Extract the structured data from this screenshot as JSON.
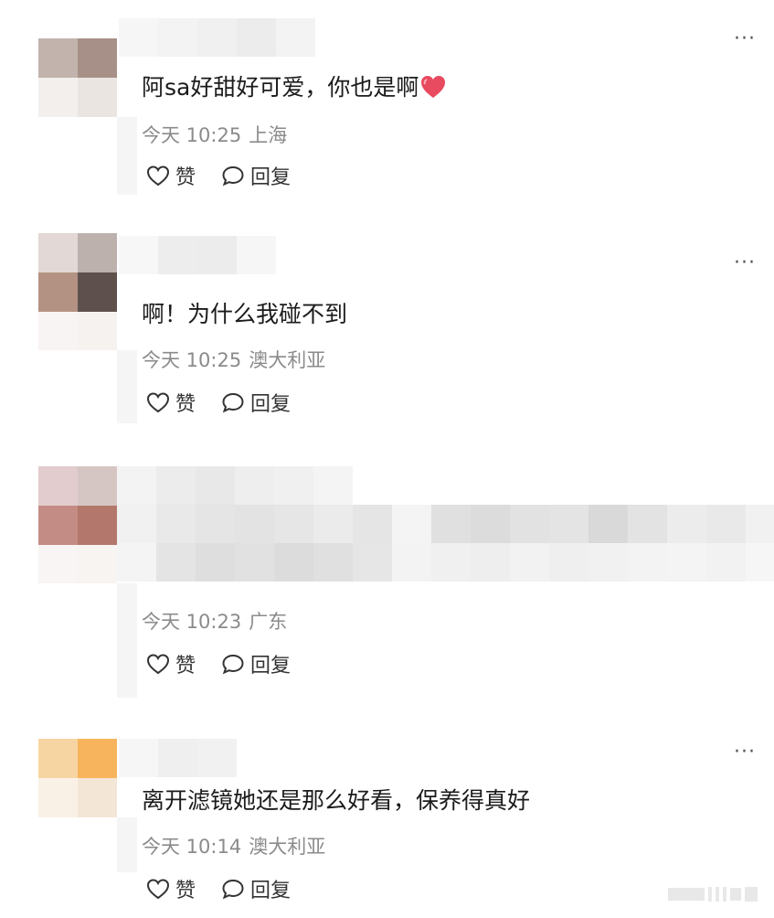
{
  "comments": [
    {
      "text": "阿sa好甜好可爱，你也是啊",
      "time": "今天 10:25",
      "location": "上海",
      "like_label": "赞",
      "reply_label": "回复",
      "avatar_colors": [
        "#c2b3ac",
        "#a79087",
        "#f3efed",
        "#ebe5e2"
      ]
    },
    {
      "text": "啊！为什么我碰不到",
      "time": "今天 10:25",
      "location": "澳大利亚",
      "like_label": "赞",
      "reply_label": "回复",
      "avatar_colors": [
        "#e2d8d5",
        "#bcb1ad",
        "#b49283",
        "#5e514d"
      ]
    },
    {
      "text": "",
      "time": "今天 10:23",
      "location": "广东",
      "like_label": "赞",
      "reply_label": "回复",
      "avatar_colors": [
        "#e2cccd",
        "#d6c6c3",
        "#c38d86",
        "#b3786b"
      ]
    },
    {
      "text": "离开滤镜她还是那么好看，保养得真好",
      "time": "今天 10:14",
      "location": "澳大利亚",
      "like_label": "赞",
      "reply_label": "回复",
      "avatar_colors": [
        "#f7d5a2",
        "#f7b45c",
        "#faf1e6",
        "#f4e6d7"
      ]
    }
  ],
  "more_glyph": "···",
  "accent_heart_color": "#e84a5f"
}
